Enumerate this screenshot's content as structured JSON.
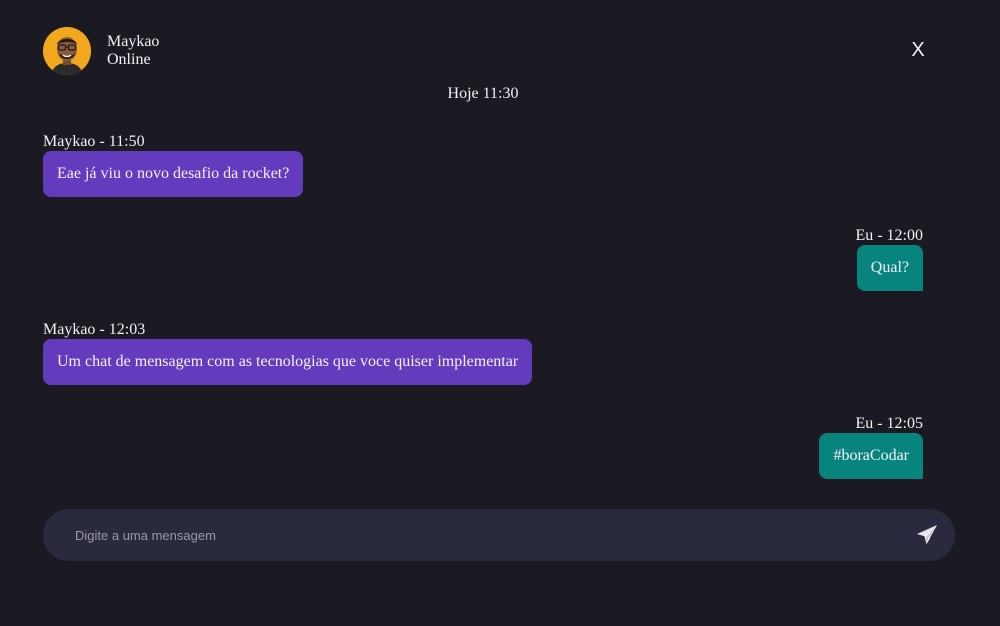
{
  "contact": {
    "name": "Maykao",
    "status": "Online"
  },
  "close_label": "X",
  "date_divider": "Hoje 11:30",
  "messages": [
    {
      "meta": "Maykao - 11:50",
      "text": "Eae já viu o novo desafio da rocket?",
      "direction": "in"
    },
    {
      "meta": "Eu - 12:00",
      "text": "Qual?",
      "direction": "out"
    },
    {
      "meta": "Maykao - 12:03",
      "text": "Um chat de mensagem com as tecnologias que voce quiser implementar",
      "direction": "in"
    },
    {
      "meta": "Eu - 12:05",
      "text": "#boraCodar",
      "direction": "out"
    }
  ],
  "composer": {
    "placeholder": "Digite a uma mensagem",
    "value": ""
  },
  "colors": {
    "background": "#1b1a23",
    "incoming_bubble": "#633bbc",
    "outgoing_bubble": "#07847e",
    "composer": "#2a2a3f",
    "avatar_ring": "#f2a81d"
  },
  "icons": {
    "close": "close-icon",
    "send": "send-icon",
    "avatar": "avatar"
  }
}
